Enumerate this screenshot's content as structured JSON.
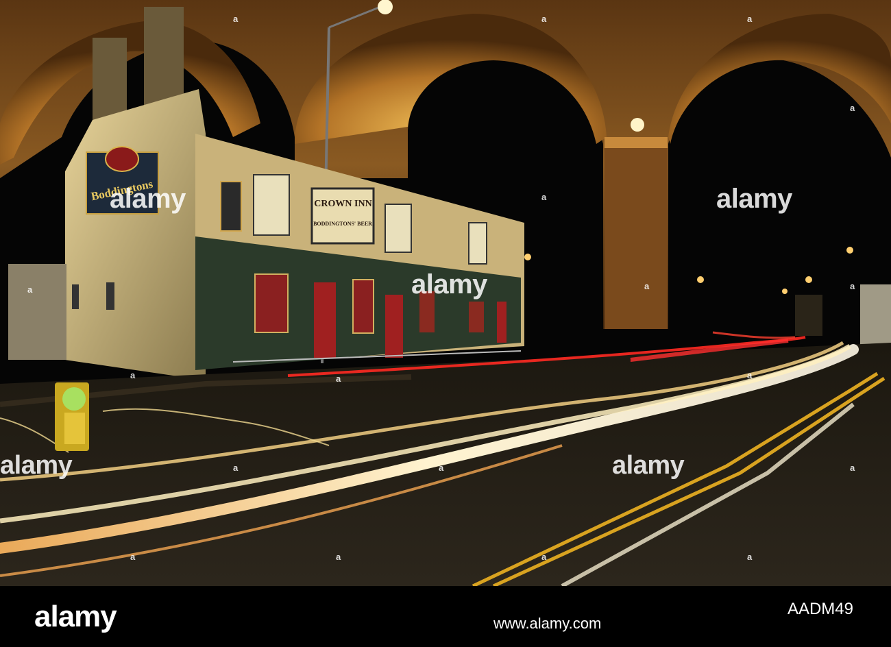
{
  "signage": {
    "side_sign": "Boddingtons",
    "front_sign_top": "CROWN INN",
    "front_sign_bottom": "BODDINGTONS' BEER."
  },
  "watermarks": {
    "brand": "alamy",
    "small": "a"
  },
  "footer": {
    "logo": "alamy",
    "url": "www.alamy.com",
    "image_id": "AADM49"
  },
  "colors": {
    "brick_lit": "#a86a2a",
    "sky": "#050505",
    "pub_wall": "#c9b27a",
    "light_trail": "#fff1c0",
    "road_line": "#d9a320"
  }
}
